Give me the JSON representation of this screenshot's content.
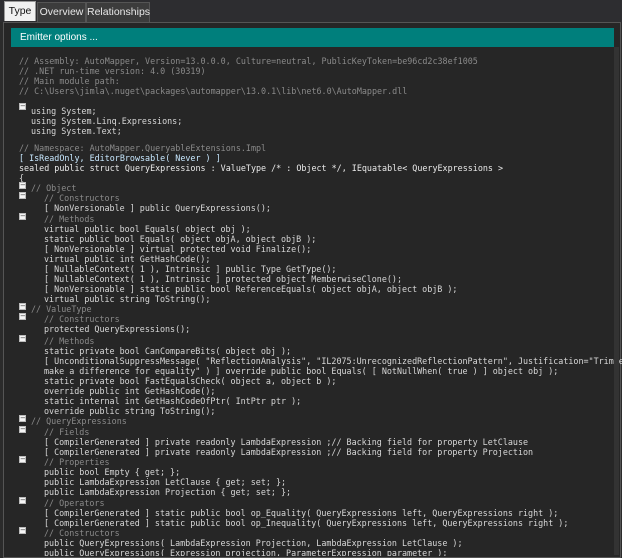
{
  "tabs": [
    "Type",
    "Overview",
    "Relationships"
  ],
  "emitter_label": "Emitter options ...",
  "lines": [
    "// Assembly: AutoMapper, Version=13.0.0.0, Culture=neutral, PublicKeyToken=be96cd2c38ef1005",
    "// .NET run-time version: 4.0 (30319)",
    "// Main module path:",
    "// C:\\Users\\jimla\\.nuget\\packages\\automapper\\13.0.1\\lib\\net6.0\\AutoMapper.dll",
    "using System;",
    "using System.Linq.Expressions;",
    "using System.Text;",
    "// Namespace: AutoMapper.QueryableExtensions.Impl",
    "[ IsReadOnly, EditorBrowsable( Never ) ]",
    "sealed public struct QueryExpressions : ValueType /* : Object */, IEquatable< QueryExpressions >",
    "{",
    "// Object",
    "// Constructors",
    "[ NonVersionable ] public QueryExpressions();",
    "// Methods",
    "virtual public bool Equals( object obj );",
    "static public bool Equals( object objA, object objB );",
    "[ NonVersionable ] virtual protected void Finalize();",
    "virtual public int GetHashCode();",
    "[ NullableContext( 1 ), Intrinsic ] public Type GetType();",
    "[ NullableContext( 1 ), Intrinsic ] protected object MemberwiseClone();",
    "[ NonVersionable ] static public bool ReferenceEquals( object objA, object objB );",
    "virtual public string ToString();",
    "// ValueType",
    "// Constructors",
    "protected QueryExpressions();",
    "// Methods",
    "static private bool CanCompareBits( object obj );",
    "[ UnconditionalSuppressMessage( \"ReflectionAnalysis\", \"IL2075:UnrecognizedReflectionPattern\", Justification=\"Trimmed fields don't",
    "make a difference for equality\" ) ] override public bool Equals( [ NotNullWhen( true ) ] object obj );",
    "static private bool FastEqualsCheck( object a, object b );",
    "override public int GetHashCode();",
    "static internal int GetHashCodeOfPtr( IntPtr ptr );",
    "override public string ToString();",
    "// QueryExpressions",
    "// Fields",
    "[ CompilerGenerated ] private readonly LambdaExpression ;// Backing field for property LetClause",
    "[ CompilerGenerated ] private readonly LambdaExpression ;// Backing field for property Projection",
    "// Properties",
    "public bool Empty { get; };",
    "public LambdaExpression LetClause { get; set; };",
    "public LambdaExpression Projection { get; set; };",
    "// Operators",
    "[ CompilerGenerated ] static public bool op_Equality( QueryExpressions left, QueryExpressions right );",
    "[ CompilerGenerated ] static public bool op_Inequality( QueryExpressions left, QueryExpressions right );",
    "// Constructors",
    "public QueryExpressions( LambdaExpression Projection, LambdaExpression LetClause );",
    "public QueryExpressions( Expression projection, ParameterExpression parameter );"
  ]
}
